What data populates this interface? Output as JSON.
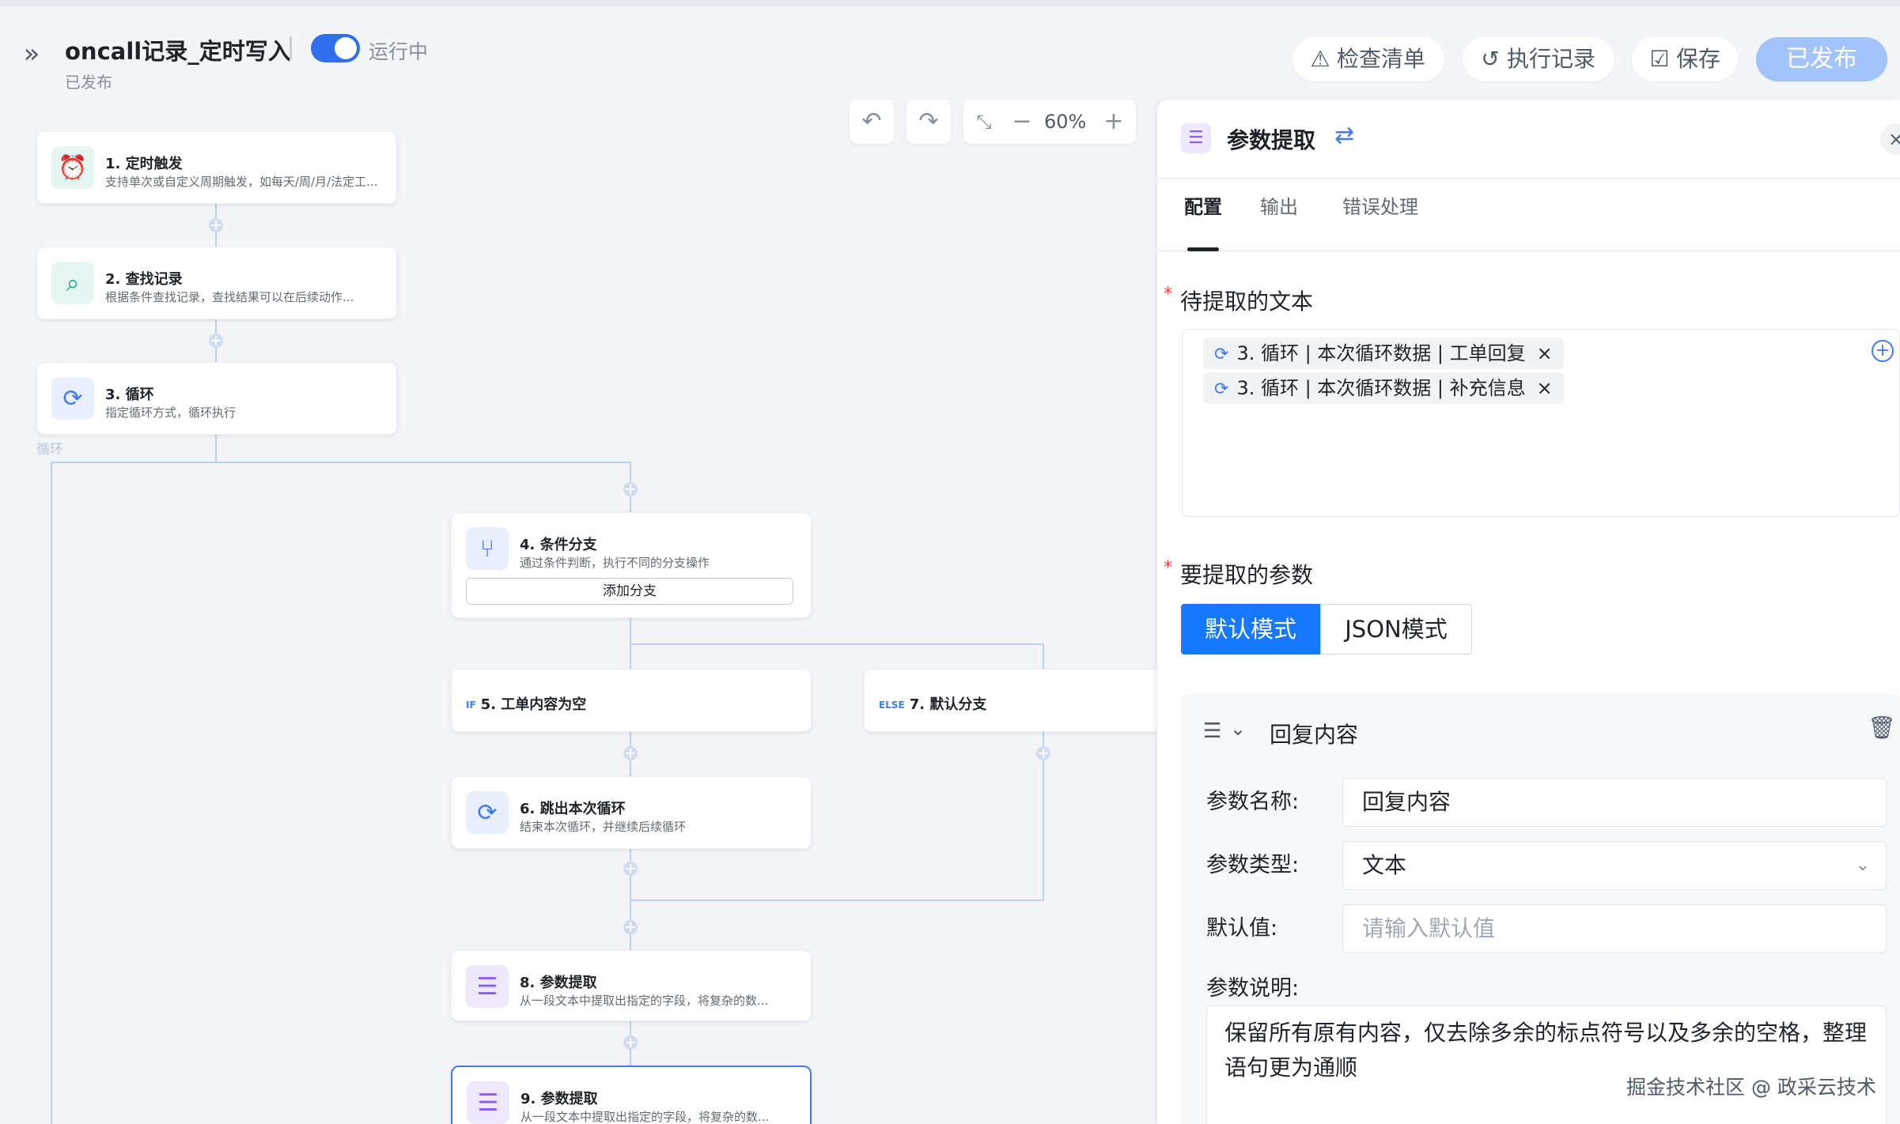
{
  "header": {
    "title": "oncall记录_定时写入",
    "run_status": "运行中",
    "publish_status": "已发布",
    "buttons": {
      "checklist": "检查清单",
      "history": "执行记录",
      "save": "保存",
      "published": "已发布"
    },
    "toggle_on": true
  },
  "canvas": {
    "zoom": "60%",
    "loop_label": "循环",
    "nodes": [
      {
        "title": "1. 定时触发",
        "desc": "支持单次或自定义周期触发，如每天/周/月/法定工...",
        "icon": "alarm-clock-icon"
      },
      {
        "title": "2. 查找记录",
        "desc": "根据条件查找记录，查找结果可以在后续动作...",
        "icon": "search-icon"
      },
      {
        "title": "3. 循环",
        "desc": "指定循环方式，循环执行",
        "icon": "loop-icon"
      },
      {
        "title": "4. 条件分支",
        "desc": "通过条件判断，执行不同的分支操作",
        "icon": "branch-icon",
        "add_branch": "添加分支"
      },
      {
        "title": "5. 工单内容为空",
        "tag": "IF"
      },
      {
        "title": "7. 默认分支",
        "tag": "ELSE"
      },
      {
        "title": "6. 跳出本次循环",
        "desc": "结束本次循环，并继续后续循环",
        "icon": "loop-icon"
      },
      {
        "title": "8. 参数提取",
        "desc": "从一段文本中提取出指定的字段，将复杂的数...",
        "icon": "param-extract-icon"
      },
      {
        "title": "9. 参数提取",
        "desc": "从一段文本中提取出指定的字段，将复杂的数...",
        "icon": "param-extract-icon"
      }
    ]
  },
  "panel": {
    "title": "参数提取",
    "tabs": [
      "配置",
      "输出",
      "错误处理"
    ],
    "active_tab": "配置",
    "text_label": "待提取的文本",
    "chips": [
      "3. 循环 | 本次循环数据 | 工单回复",
      "3. 循环 | 本次循环数据 | 补充信息"
    ],
    "params_label": "要提取的参数",
    "modes": {
      "default": "默认模式",
      "json": "JSON模式"
    },
    "param": {
      "header": "回复内容",
      "name_label": "参数名称:",
      "name_value": "回复内容",
      "type_label": "参数类型:",
      "type_value": "文本",
      "default_label": "默认值:",
      "default_placeholder": "请输入默认值",
      "desc_label": "参数说明:",
      "desc_value": "保留所有原有内容，仅去除多余的标点符号以及多余的空格，整理语句更为通顺"
    }
  },
  "watermark": "掘金技术社区 @ 政采云技术",
  "colors": {
    "accent": "#1677ff",
    "publish_disabled": "#a3c3fb",
    "required": "#f53f3f"
  }
}
